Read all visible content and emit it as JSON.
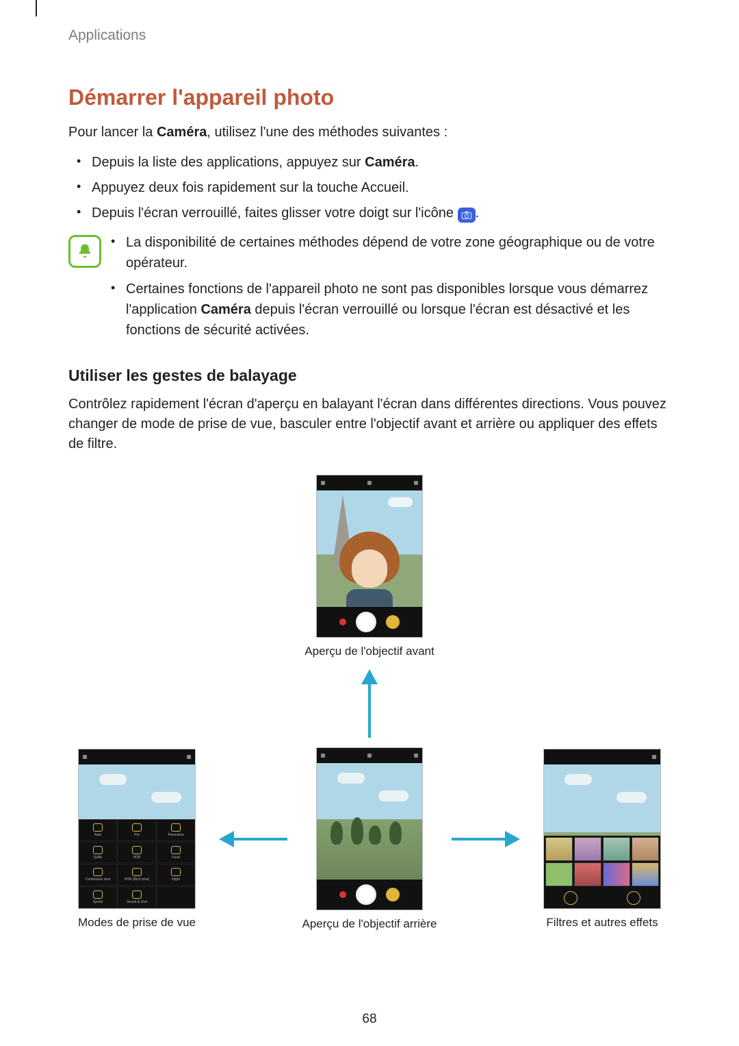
{
  "header": {
    "section": "Applications"
  },
  "title": "Démarrer l'appareil photo",
  "intro_parts": {
    "a": "Pour lancer la ",
    "b": "Caméra",
    "c": ", utilisez l'une des méthodes suivantes :"
  },
  "bullets": {
    "b1": {
      "a": "Depuis la liste des applications, appuyez sur ",
      "b": "Caméra",
      "c": "."
    },
    "b2": "Appuyez deux fois rapidement sur la touche Accueil.",
    "b3": {
      "a": "Depuis l'écran verrouillé, faites glisser votre doigt sur l'icône ",
      "b": "."
    }
  },
  "note": {
    "n1": "La disponibilité de certaines méthodes dépend de votre zone géographique ou de votre opérateur.",
    "n2": {
      "a": "Certaines fonctions de l'appareil photo ne sont pas disponibles lorsque vous démarrez l'application ",
      "b": "Caméra",
      "c": " depuis l'écran verrouillé ou lorsque l'écran est désactivé et les fonctions de sécurité activées."
    }
  },
  "h2": "Utiliser les gestes de balayage",
  "para": "Contrôlez rapidement l'écran d'aperçu en balayant l'écran dans différentes directions. Vous pouvez changer de mode de prise de vue, basculer entre l'objectif avant et arrière ou appliquer des effets de filtre.",
  "captions": {
    "front": "Aperçu de l'objectif avant",
    "modes": "Modes de prise de vue",
    "rear": "Aperçu de l'objectif arrière",
    "filters": "Filtres et autres effets"
  },
  "page_number": "68"
}
